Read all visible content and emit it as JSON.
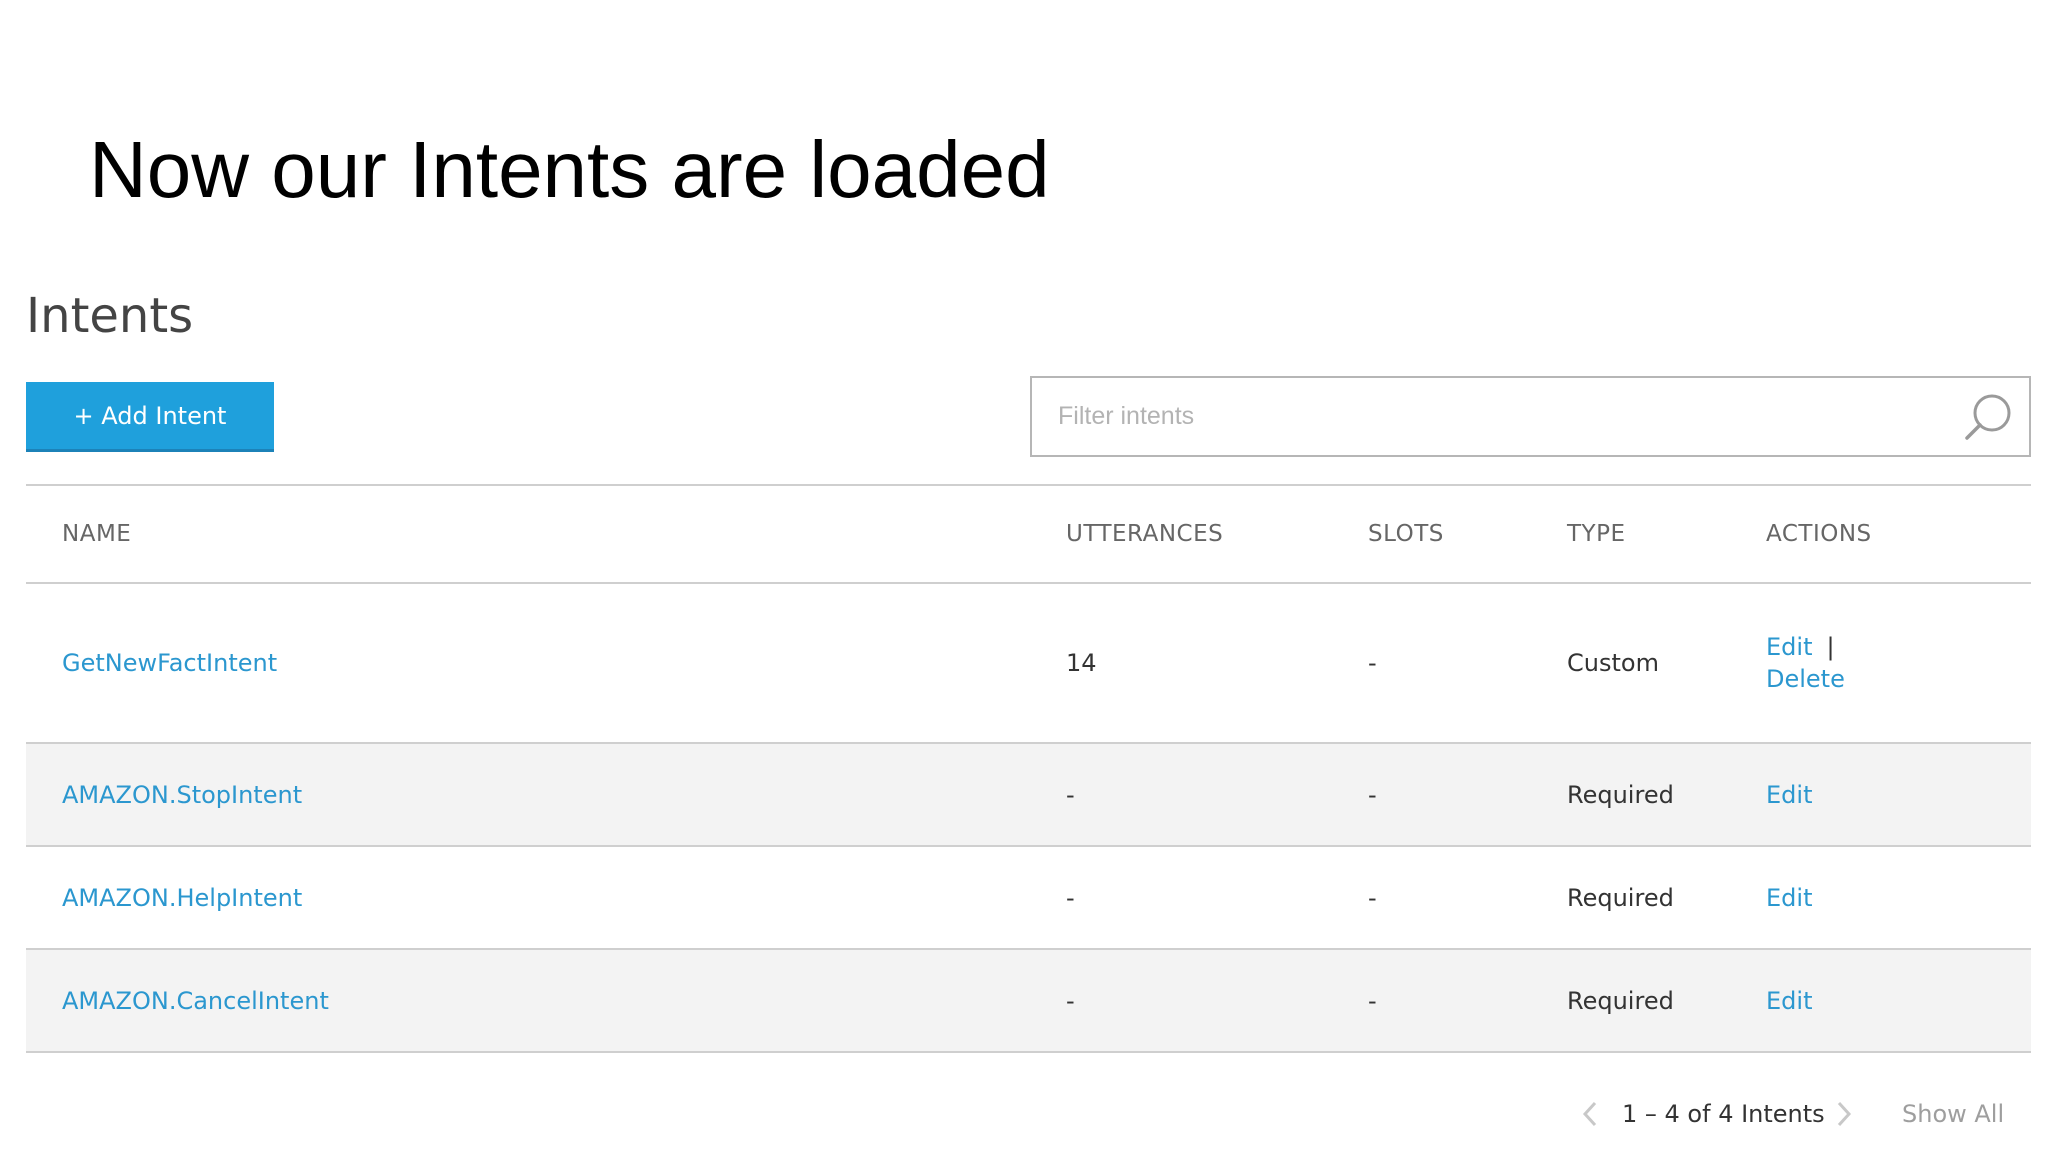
{
  "slide": {
    "title": "Now our Intents are loaded"
  },
  "page": {
    "heading": "Intents",
    "add_button_label": "+ Add Intent",
    "filter_placeholder": "Filter intents",
    "icons": {
      "search": "search-icon",
      "prev": "chevron-left-icon",
      "next": "chevron-right-icon"
    },
    "colors": {
      "accent": "#1fa0dc",
      "link": "#2b97cf",
      "row_alt": "#f3f3f3"
    }
  },
  "table": {
    "columns": [
      "NAME",
      "UTTERANCES",
      "SLOTS",
      "TYPE",
      "ACTIONS"
    ],
    "rows": [
      {
        "name": "GetNewFactIntent",
        "utterances": "14",
        "slots": "-",
        "type": "Custom",
        "actions": [
          "Edit",
          "Delete"
        ],
        "separator": "|"
      },
      {
        "name": "AMAZON.StopIntent",
        "utterances": "-",
        "slots": "-",
        "type": "Required",
        "actions": [
          "Edit"
        ]
      },
      {
        "name": "AMAZON.HelpIntent",
        "utterances": "-",
        "slots": "-",
        "type": "Required",
        "actions": [
          "Edit"
        ]
      },
      {
        "name": "AMAZON.CancelIntent",
        "utterances": "-",
        "slots": "-",
        "type": "Required",
        "actions": [
          "Edit"
        ]
      }
    ]
  },
  "pagination": {
    "summary": "1 – 4 of 4 Intents",
    "show_all_label": "Show All"
  }
}
